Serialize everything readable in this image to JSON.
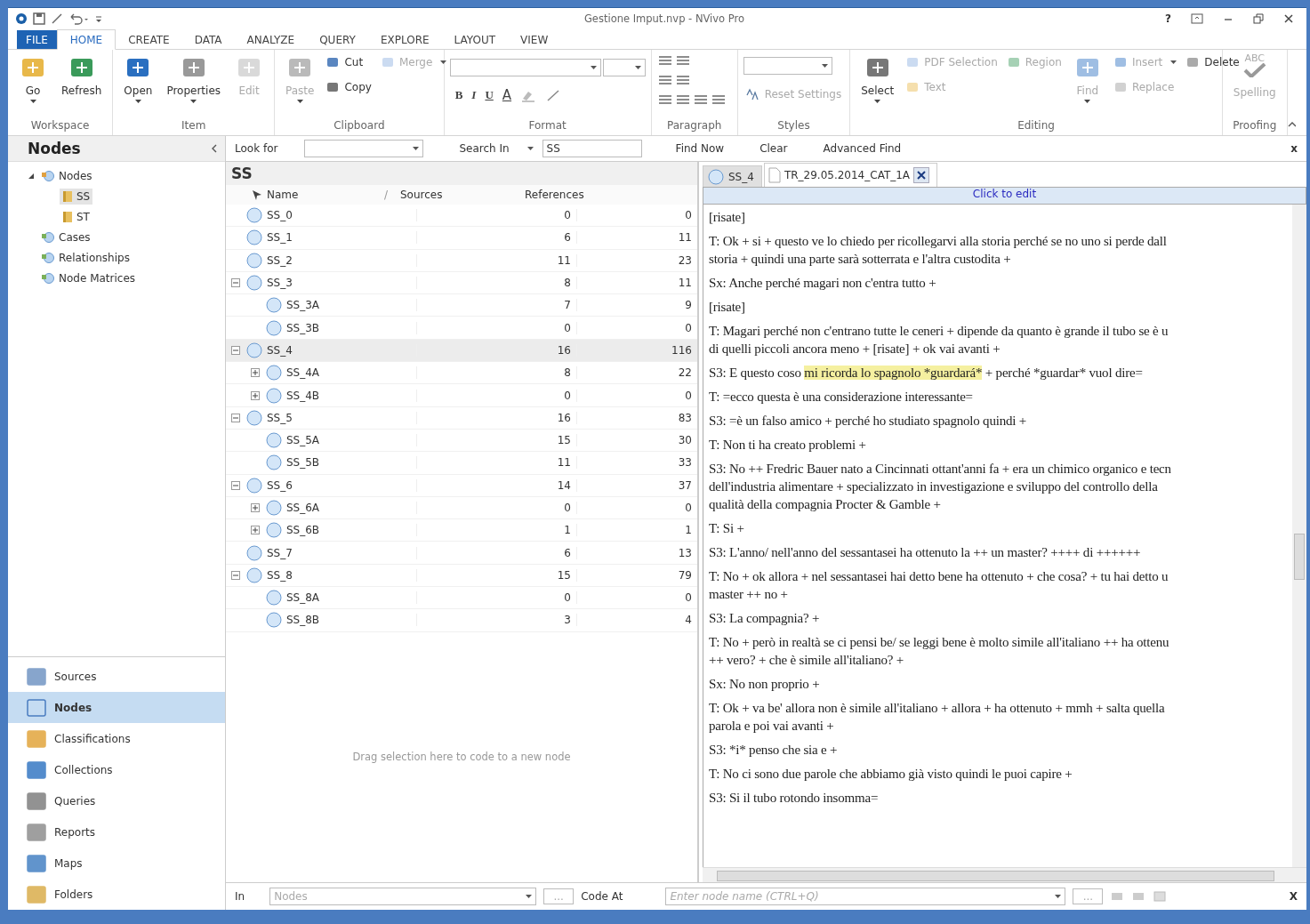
{
  "window": {
    "title": "Gestione Imput.nvp - NVivo Pro",
    "help": "?"
  },
  "ribbon_tabs": [
    {
      "label": "FILE",
      "kind": "file",
      "selected": false
    },
    {
      "label": "HOME",
      "kind": "tab",
      "selected": true
    },
    {
      "label": "CREATE",
      "kind": "tab",
      "selected": false
    },
    {
      "label": "DATA",
      "kind": "tab",
      "selected": false
    },
    {
      "label": "ANALYZE",
      "kind": "tab",
      "selected": false
    },
    {
      "label": "QUERY",
      "kind": "tab",
      "selected": false
    },
    {
      "label": "EXPLORE",
      "kind": "tab",
      "selected": false
    },
    {
      "label": "LAYOUT",
      "kind": "tab",
      "selected": false
    },
    {
      "label": "VIEW",
      "kind": "tab",
      "selected": false
    }
  ],
  "ribbon_groups": [
    {
      "label": "Workspace",
      "kind": "commands",
      "commands": [
        {
          "label": "Go",
          "kind": "large",
          "disabled": false,
          "caret": true
        },
        {
          "label": "Refresh",
          "kind": "large",
          "disabled": false,
          "caret": false
        }
      ]
    },
    {
      "label": "Item",
      "kind": "commands",
      "commands": [
        {
          "label": "Open",
          "kind": "large",
          "disabled": false,
          "caret": true
        },
        {
          "label": "Properties",
          "kind": "large",
          "disabled": false,
          "caret": true
        },
        {
          "label": "Edit",
          "kind": "large",
          "disabled": true,
          "caret": false
        }
      ]
    },
    {
      "label": "Clipboard",
      "kind": "commands",
      "commands": [
        {
          "label": "Paste",
          "kind": "large",
          "disabled": true,
          "caret": true
        },
        {
          "label": "Cut",
          "kind": "small",
          "disabled": false,
          "caret": false
        },
        {
          "label": "Copy",
          "kind": "small",
          "disabled": false,
          "caret": false
        },
        {
          "label": "Merge",
          "kind": "small",
          "disabled": true,
          "caret": true
        }
      ]
    },
    {
      "label": "Format",
      "kind": "format",
      "format_buttons": [
        "B",
        "I",
        "U",
        "A"
      ]
    },
    {
      "label": "Paragraph",
      "kind": "paragraph"
    },
    {
      "label": "Styles",
      "kind": "styles",
      "commands": [
        {
          "label": "Reset Settings",
          "kind": "small",
          "disabled": true,
          "caret": false
        }
      ]
    },
    {
      "label": "Editing",
      "kind": "commands",
      "commands": [
        {
          "label": "Select",
          "kind": "large",
          "disabled": false,
          "caret": true
        },
        {
          "label": "PDF Selection",
          "kind": "small",
          "disabled": true,
          "caret": false
        },
        {
          "label": "Text",
          "kind": "small",
          "disabled": true,
          "caret": false
        },
        {
          "label": "Region",
          "kind": "small",
          "disabled": true,
          "caret": false
        },
        {
          "label": "Find",
          "kind": "large",
          "disabled": true,
          "caret": true
        },
        {
          "label": "Insert",
          "kind": "small",
          "disabled": true,
          "caret": true
        },
        {
          "label": "Replace",
          "kind": "small",
          "disabled": true,
          "caret": false
        },
        {
          "label": "Delete",
          "kind": "small",
          "disabled": false,
          "caret": false
        }
      ]
    },
    {
      "label": "Proofing",
      "kind": "commands",
      "commands": [
        {
          "label": "Spelling",
          "kind": "large",
          "disabled": true,
          "caret": false,
          "icon_text": "ABC"
        }
      ]
    }
  ],
  "navigation": {
    "title": "Nodes",
    "tree": [
      {
        "label": "Nodes",
        "expanded": true,
        "selected": false,
        "children": [
          {
            "label": "SS",
            "selected": true
          },
          {
            "label": "ST",
            "selected": false
          }
        ]
      },
      {
        "label": "Cases",
        "selected": false
      },
      {
        "label": "Relationships",
        "selected": false
      },
      {
        "label": "Node Matrices",
        "selected": false
      }
    ],
    "buttons": [
      {
        "label": "Sources",
        "selected": false
      },
      {
        "label": "Nodes",
        "selected": true
      },
      {
        "label": "Classifications",
        "selected": false
      },
      {
        "label": "Collections",
        "selected": false
      },
      {
        "label": "Queries",
        "selected": false
      },
      {
        "label": "Reports",
        "selected": false
      },
      {
        "label": "Maps",
        "selected": false
      },
      {
        "label": "Folders",
        "selected": false
      }
    ]
  },
  "find_bar": {
    "look_for_label": "Look for",
    "search_in": "Search In",
    "search_value": "SS",
    "find_now": "Find Now",
    "clear": "Clear",
    "advanced_find": "Advanced Find",
    "close": "x"
  },
  "node_list": {
    "title": "SS",
    "columns": [
      "Name",
      "Sources",
      "References"
    ],
    "sort_mark": "/",
    "rows": [
      {
        "name": "SS_0",
        "sources": "0",
        "references": "0",
        "expandable": false,
        "selected": false
      },
      {
        "name": "SS_1",
        "sources": "6",
        "references": "11",
        "expandable": false,
        "selected": false
      },
      {
        "name": "SS_2",
        "sources": "11",
        "references": "23",
        "expandable": false,
        "selected": false
      },
      {
        "name": "SS_3",
        "sources": "8",
        "references": "11",
        "expandable": true,
        "expanded": true,
        "selected": false,
        "children": [
          {
            "name": "SS_3A",
            "sources": "7",
            "references": "9",
            "expandable": false,
            "selected": false
          },
          {
            "name": "SS_3B",
            "sources": "0",
            "references": "0",
            "expandable": false,
            "selected": false
          }
        ]
      },
      {
        "name": "SS_4",
        "sources": "16",
        "references": "116",
        "expandable": true,
        "expanded": true,
        "selected": true,
        "children": [
          {
            "name": "SS_4A",
            "sources": "8",
            "references": "22",
            "expandable": true,
            "expanded": false,
            "selected": false
          },
          {
            "name": "SS_4B",
            "sources": "0",
            "references": "0",
            "expandable": true,
            "expanded": false,
            "selected": false
          }
        ]
      },
      {
        "name": "SS_5",
        "sources": "16",
        "references": "83",
        "expandable": true,
        "expanded": true,
        "selected": false,
        "children": [
          {
            "name": "SS_5A",
            "sources": "15",
            "references": "30",
            "expandable": false,
            "selected": false
          },
          {
            "name": "SS_5B",
            "sources": "11",
            "references": "33",
            "expandable": false,
            "selected": false
          }
        ]
      },
      {
        "name": "SS_6",
        "sources": "14",
        "references": "37",
        "expandable": true,
        "expanded": true,
        "selected": false,
        "children": [
          {
            "name": "SS_6A",
            "sources": "0",
            "references": "0",
            "expandable": true,
            "expanded": false,
            "selected": false
          },
          {
            "name": "SS_6B",
            "sources": "1",
            "references": "1",
            "expandable": true,
            "expanded": false,
            "selected": false
          }
        ]
      },
      {
        "name": "SS_7",
        "sources": "6",
        "references": "13",
        "expandable": false,
        "selected": false
      },
      {
        "name": "SS_8",
        "sources": "15",
        "references": "79",
        "expandable": true,
        "expanded": true,
        "selected": false,
        "children": [
          {
            "name": "SS_8A",
            "sources": "0",
            "references": "0",
            "expandable": false,
            "selected": false
          },
          {
            "name": "SS_8B",
            "sources": "3",
            "references": "4",
            "expandable": false,
            "selected": false
          }
        ]
      }
    ],
    "drop_hint": "Drag selection here to code to a new node"
  },
  "document": {
    "tabs": [
      {
        "label": "SS_4",
        "kind": "node",
        "selected": false
      },
      {
        "label": "TR_29.05.2014_CAT_1A",
        "kind": "source",
        "selected": true
      }
    ],
    "edit_bar": "Click to edit",
    "paragraphs": [
      {
        "kind": "plain",
        "lines": [
          "[risate]"
        ]
      },
      {
        "kind": "plain",
        "lines": [
          "T: Ok + si + questo ve lo chiedo per ricollegarvi alla storia perché se no uno si perde dall",
          "storia + quindi una parte sarà sotterrata e l'altra custodita +"
        ]
      },
      {
        "kind": "plain",
        "lines": [
          "Sx: Anche perché magari non c'entra tutto +"
        ]
      },
      {
        "kind": "plain",
        "lines": [
          "[risate]"
        ]
      },
      {
        "kind": "plain",
        "lines": [
          "T: Magari perché non c'entrano tutte le ceneri + dipende da quanto è grande il tubo se è u",
          "di quelli piccoli ancora meno + [risate] + ok vai avanti +"
        ]
      },
      {
        "kind": "coded",
        "segments": [
          {
            "text": "S3: E questo coso ",
            "highlighted": false
          },
          {
            "text": "mi ricorda lo spagnolo *guardará*",
            "highlighted": true
          },
          {
            "text": " + perché *guardar* vuol dire=",
            "highlighted": false
          }
        ]
      },
      {
        "kind": "plain",
        "lines": [
          "T: =ecco questa è una considerazione interessante="
        ]
      },
      {
        "kind": "plain",
        "lines": [
          "S3: =è un falso amico + perché ho studiato spagnolo quindi +"
        ]
      },
      {
        "kind": "plain",
        "lines": [
          "T: Non ti ha creato problemi +"
        ]
      },
      {
        "kind": "plain",
        "lines": [
          "S3: No ++ Fredric Bauer nato a Cincinnati ottant'anni fa + era un chimico organico e tecn",
          "dell'industria alimentare + specializzato in investigazione e sviluppo del controllo della",
          "qualità della compagnia Procter & Gamble +"
        ]
      },
      {
        "kind": "plain",
        "lines": [
          "T: Si +"
        ]
      },
      {
        "kind": "plain",
        "lines": [
          "S3: L'anno/ nell'anno del sessantasei ha ottenuto la ++ un master? ++++ di ++++++"
        ]
      },
      {
        "kind": "plain",
        "lines": [
          "T: No + ok allora + nel sessantasei hai detto bene ha ottenuto + che cosa? + tu hai detto u",
          "master ++ no +"
        ]
      },
      {
        "kind": "plain",
        "lines": [
          "S3: La compagnia? +"
        ]
      },
      {
        "kind": "plain",
        "lines": [
          "T: No + però in realtà se ci pensi be/ se leggi bene è molto simile all'italiano ++ ha ottenu",
          "++ vero? + che è simile all'italiano? +"
        ]
      },
      {
        "kind": "plain",
        "lines": [
          "Sx: No non proprio +"
        ]
      },
      {
        "kind": "plain",
        "lines": [
          "T: Ok + va be' allora non è simile all'italiano + allora + ha ottenuto + mmh + salta quella",
          "parola e poi vai avanti +"
        ]
      },
      {
        "kind": "plain",
        "lines": [
          "S3: *i* penso che sia e +"
        ]
      },
      {
        "kind": "plain",
        "lines": [
          "T: No ci sono due parole che abbiamo già visto quindi le puoi capire +"
        ]
      },
      {
        "kind": "plain",
        "lines": [
          "S3: Si il tubo rotondo insomma="
        ]
      }
    ]
  },
  "code_bar": {
    "in_label": "In",
    "in_placeholder": "Nodes",
    "browse": "...",
    "code_at": "Code At",
    "node_placeholder": "Enter node name (CTRL+Q)",
    "browse_2": "...",
    "close": "X"
  }
}
